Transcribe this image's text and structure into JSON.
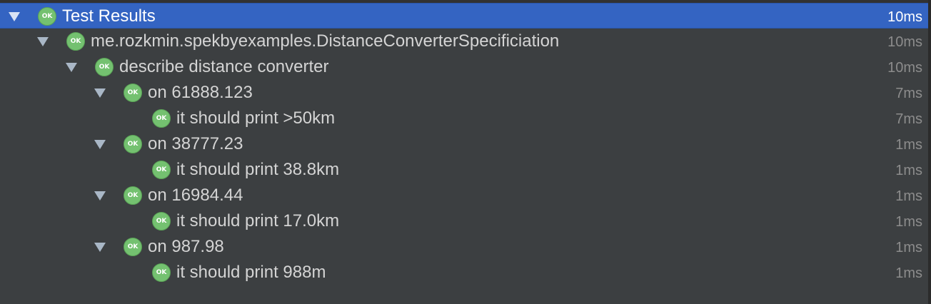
{
  "ok_icon_text": "OK",
  "colors": {
    "background": "#3c3f41",
    "selection": "#3464c2",
    "ok_green": "#74c170",
    "text": "#d4d4d4",
    "duration": "#8c8c8c"
  },
  "tree": [
    {
      "label": "Test Results",
      "duration": "10ms",
      "level": 0,
      "expandable": true,
      "selected": true
    },
    {
      "label": "me.rozkmin.spekbyexamples.DistanceConverterSpecificiation",
      "duration": "10ms",
      "level": 1,
      "expandable": true,
      "selected": false
    },
    {
      "label": "describe distance converter",
      "duration": "10ms",
      "level": 2,
      "expandable": true,
      "selected": false
    },
    {
      "label": "on 61888.123",
      "duration": "7ms",
      "level": 3,
      "expandable": true,
      "selected": false
    },
    {
      "label": "it should print >50km",
      "duration": "7ms",
      "level": 4,
      "expandable": false,
      "selected": false
    },
    {
      "label": "on 38777.23",
      "duration": "1ms",
      "level": 3,
      "expandable": true,
      "selected": false
    },
    {
      "label": "it should print 38.8km",
      "duration": "1ms",
      "level": 4,
      "expandable": false,
      "selected": false
    },
    {
      "label": "on 16984.44",
      "duration": "1ms",
      "level": 3,
      "expandable": true,
      "selected": false
    },
    {
      "label": "it should print 17.0km",
      "duration": "1ms",
      "level": 4,
      "expandable": false,
      "selected": false
    },
    {
      "label": "on 987.98",
      "duration": "1ms",
      "level": 3,
      "expandable": true,
      "selected": false
    },
    {
      "label": "it should print 988m",
      "duration": "1ms",
      "level": 4,
      "expandable": false,
      "selected": false
    }
  ]
}
